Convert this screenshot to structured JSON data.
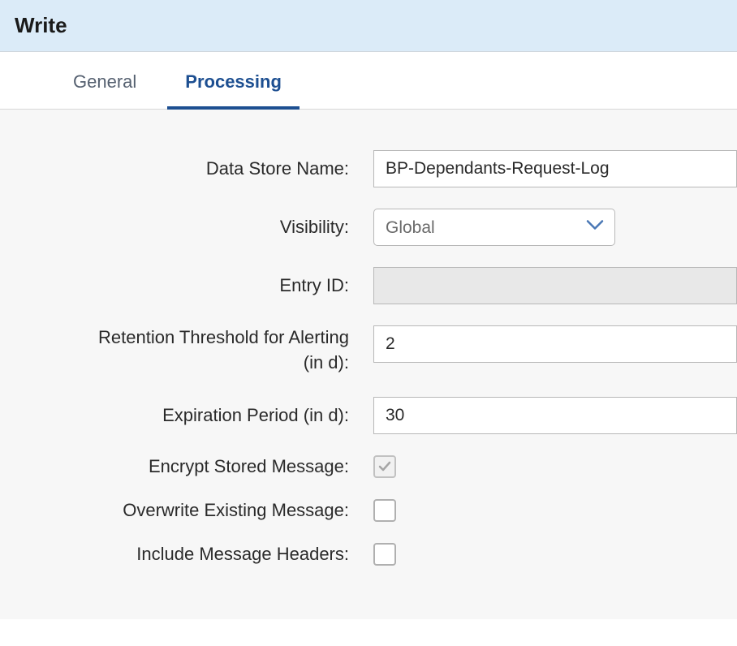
{
  "header": {
    "title": "Write"
  },
  "tabs": [
    {
      "label": "General",
      "active": false
    },
    {
      "label": "Processing",
      "active": true
    }
  ],
  "form": {
    "dataStoreName": {
      "label": "Data Store Name:",
      "value": "BP-Dependants-Request-Log"
    },
    "visibility": {
      "label": "Visibility:",
      "value": "Global"
    },
    "entryId": {
      "label": "Entry ID:",
      "value": ""
    },
    "retentionThreshold": {
      "label_line1": "Retention Threshold for Alerting",
      "label_line2": "(in d):",
      "value": "2"
    },
    "expirationPeriod": {
      "label": "Expiration Period (in d):",
      "value": "30"
    },
    "encryptStored": {
      "label": "Encrypt Stored Message:",
      "checked": true
    },
    "overwriteExisting": {
      "label": "Overwrite Existing Message:",
      "checked": false
    },
    "includeHeaders": {
      "label": "Include Message Headers:",
      "checked": false
    }
  }
}
